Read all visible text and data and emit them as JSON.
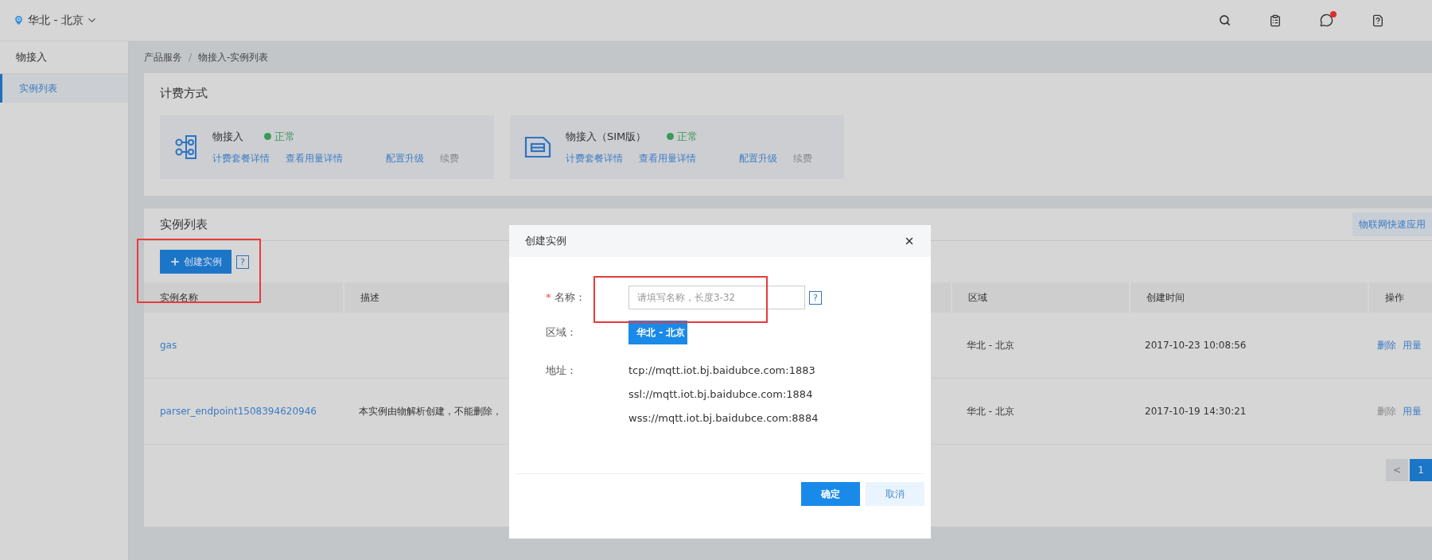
{
  "topbar": {
    "region": "华北 - 北京",
    "has_unread": true
  },
  "sidebar": {
    "title": "物接入",
    "items": [
      {
        "label": "实例列表",
        "selected": true
      }
    ]
  },
  "breadcrumb": {
    "items": [
      "产品服务",
      "物接入-实例列表"
    ],
    "separator": "/"
  },
  "billing": {
    "title": "计费方式",
    "cards": [
      {
        "kind": "nodes",
        "name": "物接入",
        "status": "正常",
        "links": [
          {
            "label": "计费套餐详情",
            "disabled": false
          },
          {
            "label": "查看用量详情",
            "disabled": false
          },
          {
            "label": "配置升级",
            "disabled": false
          },
          {
            "label": "续费",
            "disabled": true
          }
        ]
      },
      {
        "kind": "sim",
        "name": "物接入（SIM版）",
        "status": "正常",
        "links": [
          {
            "label": "计费套餐详情",
            "disabled": false
          },
          {
            "label": "查看用量详情",
            "disabled": false
          },
          {
            "label": "配置升级",
            "disabled": false
          },
          {
            "label": "续费",
            "disabled": true
          }
        ]
      }
    ]
  },
  "instances": {
    "title": "实例列表",
    "quick_button": "物联网快速应用",
    "create_button": "创建实例",
    "help": "?",
    "highlighted": true,
    "columns": [
      "实例名称",
      "描述",
      "区域",
      "创建时间",
      "操作"
    ],
    "rows": [
      {
        "name": "gas",
        "description": "",
        "region": "华北 - 北京",
        "created": "2017-10-23 10:08:56",
        "actions": [
          {
            "label": "删除",
            "disabled": false
          },
          {
            "label": "用量",
            "disabled": false
          }
        ]
      },
      {
        "name": "parser_endpoint1508394620946",
        "description": "本实例由物解析创建，不能删除，",
        "region": "华北 - 北京",
        "created": "2017-10-19 14:30:21",
        "actions": [
          {
            "label": "删除",
            "disabled": true
          },
          {
            "label": "用量",
            "disabled": false
          }
        ]
      }
    ],
    "pagination": {
      "prev": "<",
      "pages": [
        {
          "label": "1",
          "selected": true
        }
      ]
    }
  },
  "dialog": {
    "title": "创建实例",
    "name_label": "名称：",
    "required_mark": "*",
    "name_placeholder": "请填写名称，长度3-32",
    "help": "?",
    "highlighted": true,
    "region_label": "区域：",
    "region_value": "华北 - 北京",
    "address_label": "地址：",
    "addresses": [
      "tcp://mqtt.iot.bj.baidubce.com:1883",
      "ssl://mqtt.iot.bj.baidubce.com:1884",
      "wss://mqtt.iot.bj.baidubce.com:8884"
    ],
    "buttons": [
      {
        "label": "确定",
        "kind": "primary"
      },
      {
        "label": "取消",
        "kind": "secondary"
      }
    ]
  }
}
